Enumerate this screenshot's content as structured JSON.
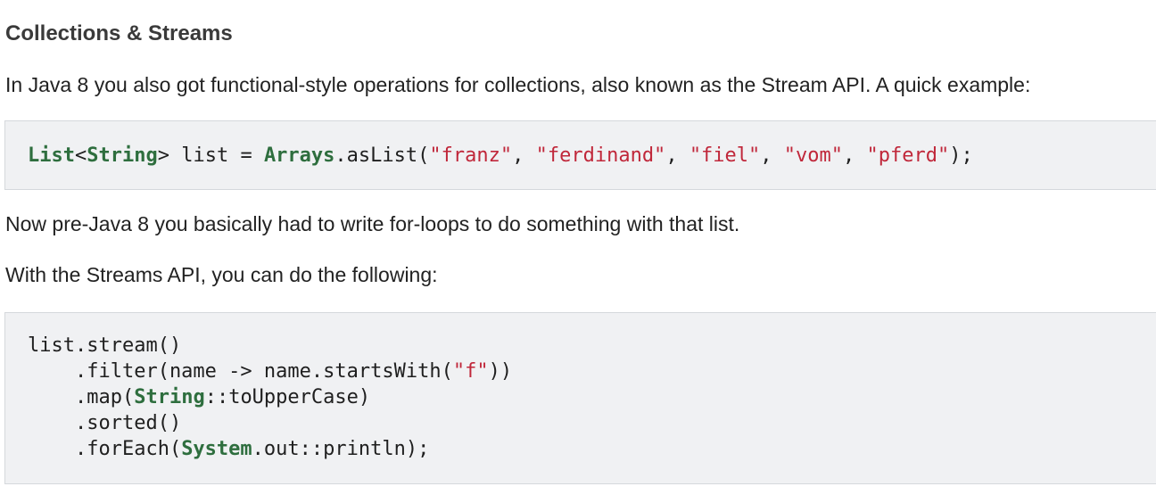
{
  "heading": "Collections & Streams",
  "intro": "In Java 8 you also got functional-style operations for collections, also known as the Stream API. A quick example:",
  "code1": {
    "type_list": "List",
    "lt": "<",
    "type_string": "String",
    "gt": ">",
    "text_assign": " list = ",
    "type_arrays": "Arrays",
    "text_aslist": ".asList(",
    "s_franz": "\"franz\"",
    "s_ferdinand": "\"ferdinand\"",
    "s_fiel": "\"fiel\"",
    "s_vom": "\"vom\"",
    "s_pferd": "\"pferd\"",
    "comma": ", ",
    "end": ");"
  },
  "para2": "Now pre-Java 8 you basically had to write for-loops to do something with that list.",
  "para3": "With the Streams API, you can do the following:",
  "code2": {
    "line1": "list.stream()",
    "line2_a": "    .filter(name -> name.startsWith(",
    "line2_str": "\"f\"",
    "line2_b": "))",
    "line3_a": "    .map(",
    "line3_type": "String",
    "line3_b": "::toUpperCase)",
    "line4": "    .sorted()",
    "line5_a": "    .forEach(",
    "line5_type": "System",
    "line5_b": ".out::println);"
  }
}
